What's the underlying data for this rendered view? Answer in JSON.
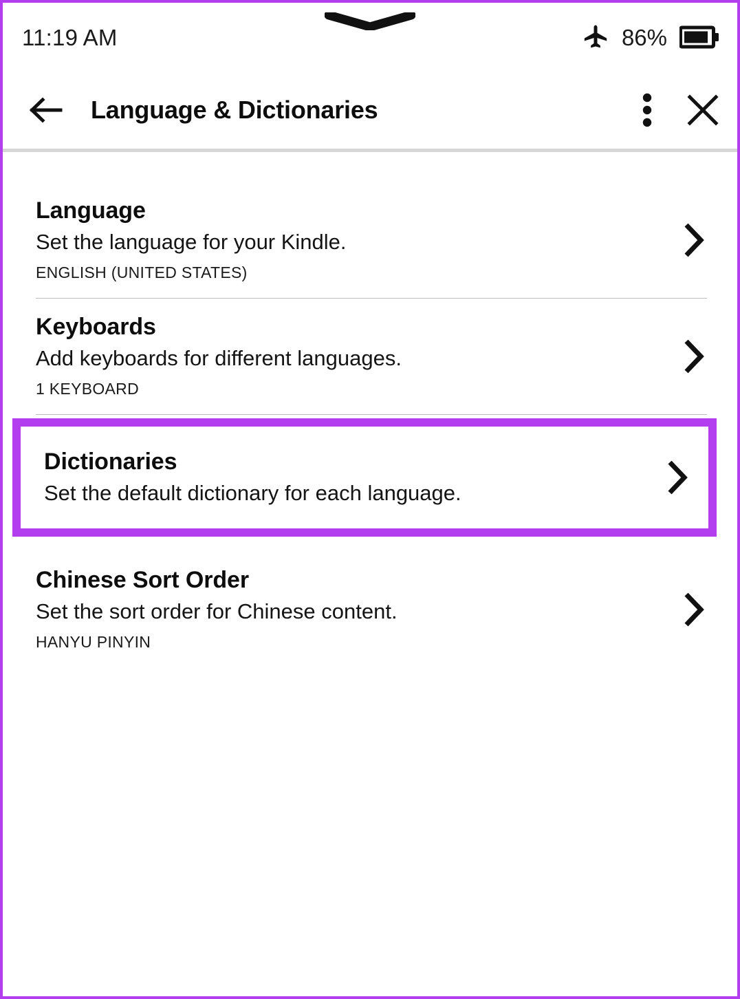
{
  "status_bar": {
    "time": "11:19 AM",
    "battery_percent": "86%",
    "airplane_icon": "airplane-mode-icon",
    "battery_icon": "battery-icon",
    "notch_handle_icon": "pull-down-chevron-handle"
  },
  "header": {
    "title": "Language & Dictionaries",
    "back_icon": "back-arrow-icon",
    "overflow_icon": "three-dot-menu-icon",
    "close_icon": "close-x-icon"
  },
  "colors": {
    "highlight": "#b33ef0",
    "divider": "#bcbcbc",
    "header_rule": "#d6d6d6",
    "text": "#0d0d0d"
  },
  "settings": [
    {
      "id": "language",
      "title": "Language",
      "description": "Set the language for your Kindle.",
      "value": "ENGLISH (UNITED STATES)",
      "chevron_icon": "chevron-right-icon",
      "highlighted": false
    },
    {
      "id": "keyboards",
      "title": "Keyboards",
      "description": "Add keyboards for different languages.",
      "value": "1 KEYBOARD",
      "chevron_icon": "chevron-right-icon",
      "highlighted": false
    },
    {
      "id": "dictionaries",
      "title": "Dictionaries",
      "description": "Set the default dictionary for each language.",
      "value": "",
      "chevron_icon": "chevron-right-icon",
      "highlighted": true
    },
    {
      "id": "chinese-sort-order",
      "title": "Chinese Sort Order",
      "description": "Set the sort order for Chinese content.",
      "value": "HANYU PINYIN",
      "chevron_icon": "chevron-right-icon",
      "highlighted": false
    }
  ]
}
